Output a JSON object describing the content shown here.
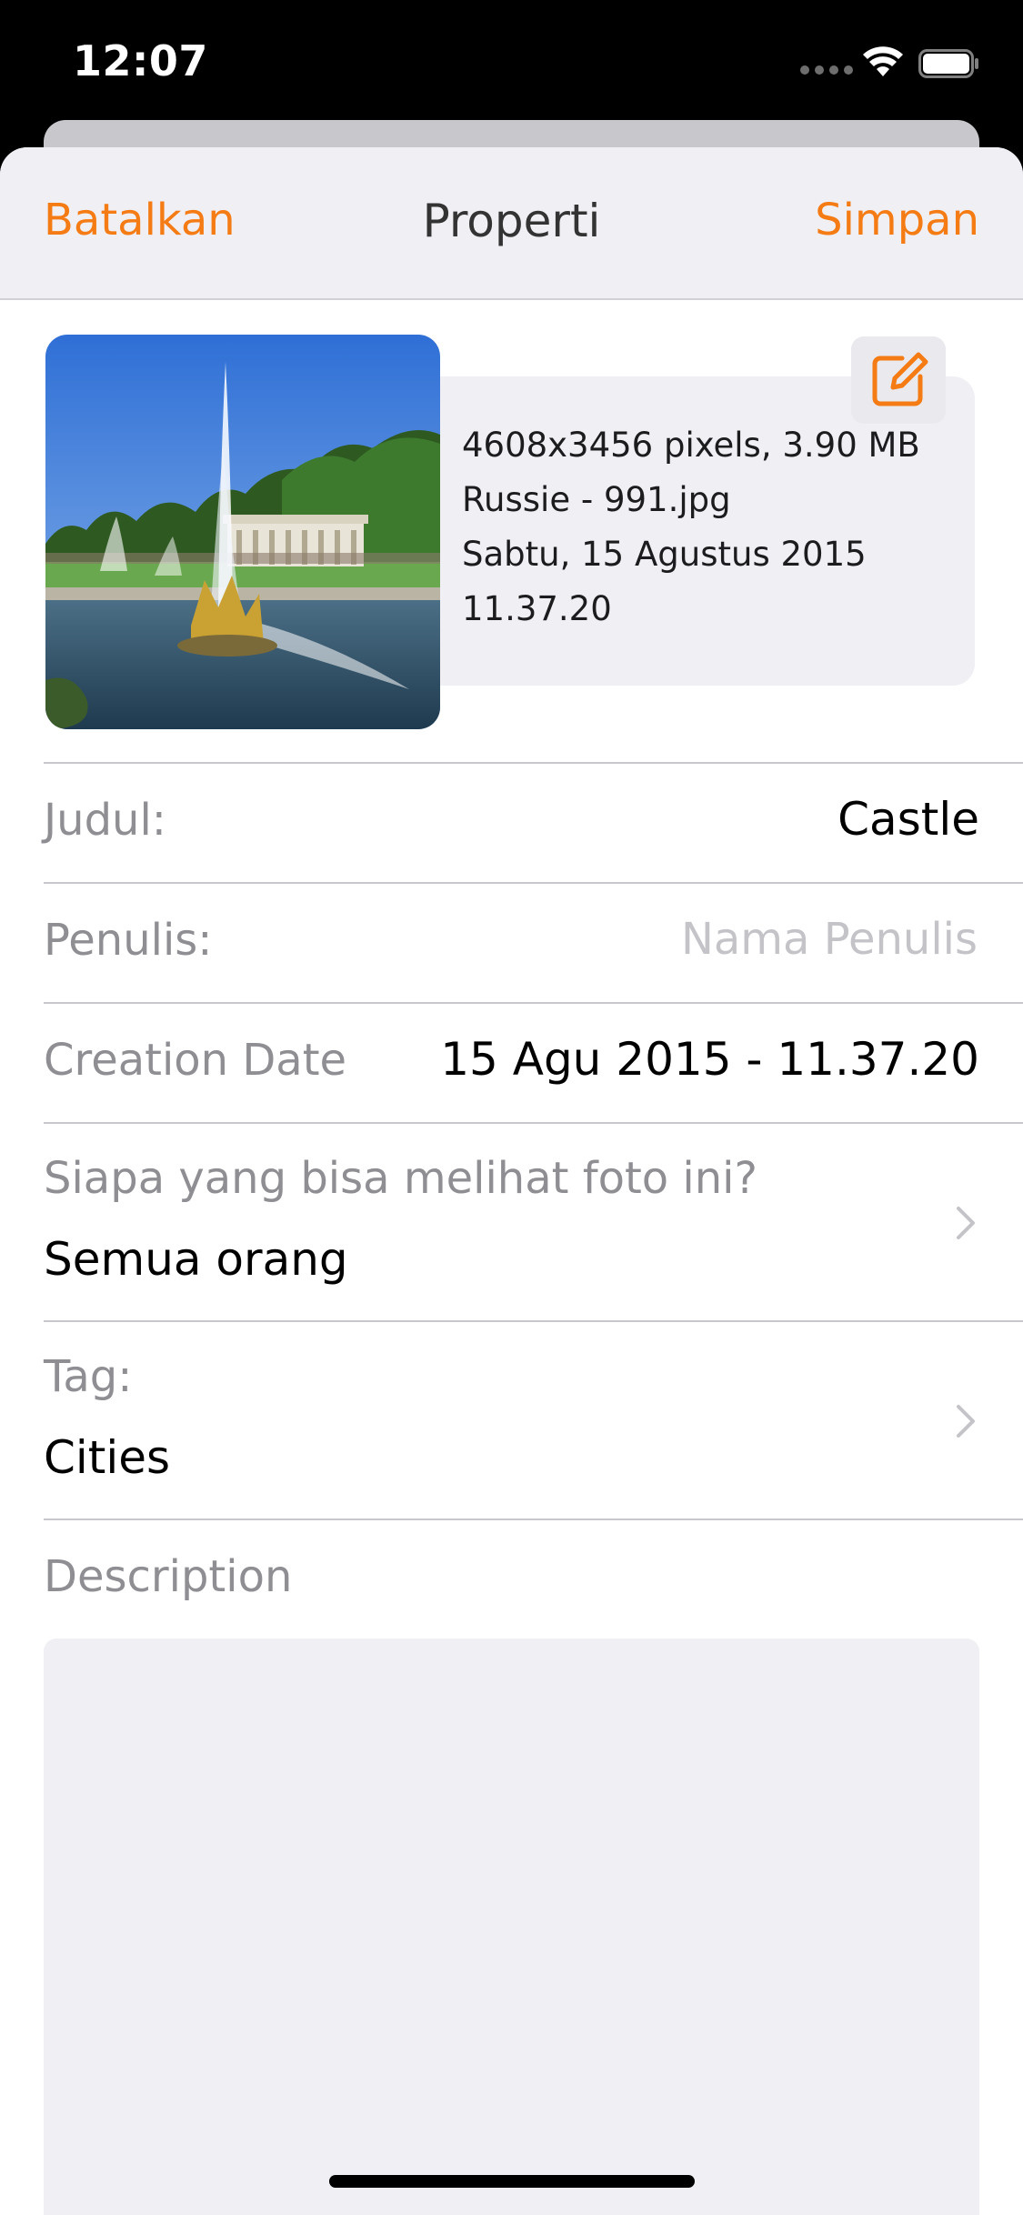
{
  "status_bar": {
    "time": "12:07"
  },
  "nav": {
    "cancel_label": "Batalkan",
    "title": "Properti",
    "save_label": "Simpan",
    "accent_color": "#f57c14"
  },
  "photo": {
    "info_lines": [
      "4608x3456 pixels, 3.90 MB",
      "Russie - 991.jpg",
      "Sabtu, 15 Agustus 2015",
      "11.37.20"
    ],
    "edit_icon": "edit-icon"
  },
  "fields": {
    "title": {
      "label": "Judul:",
      "value": "Castle"
    },
    "author": {
      "label": "Penulis:",
      "value": "",
      "placeholder": "Nama Penulis"
    },
    "creation_date": {
      "label": "Creation Date",
      "value": "15 Agu 2015 - 11.37.20"
    },
    "visibility": {
      "label": "Siapa yang bisa melihat foto ini?",
      "value": "Semua orang"
    },
    "tags": {
      "label": "Tag:",
      "value": "Cities"
    },
    "description": {
      "label": "Description",
      "value": ""
    }
  }
}
